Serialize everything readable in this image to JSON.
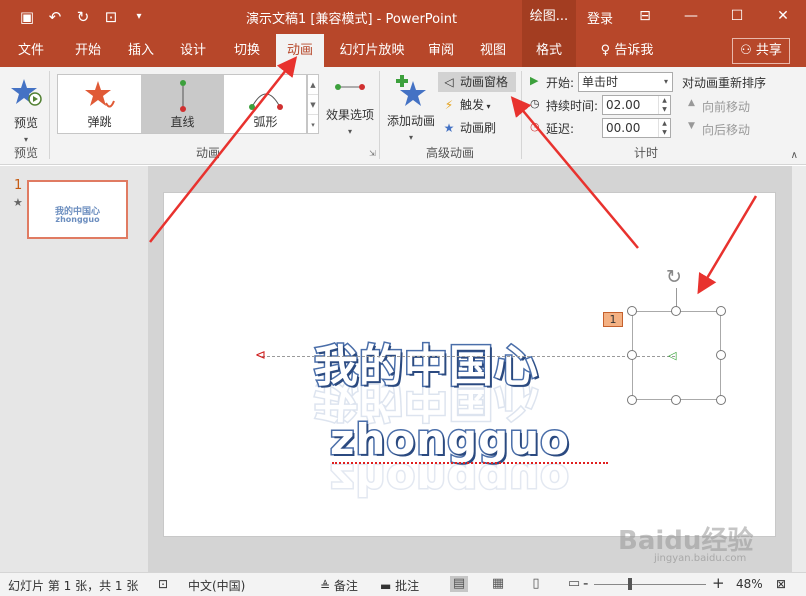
{
  "titlebar": {
    "title": "演示文稿1 [兼容模式] - PowerPoint",
    "contextual_tab_header": "绘图...",
    "login": "登录"
  },
  "tabs": {
    "file": "文件",
    "home": "开始",
    "insert": "插入",
    "design": "设计",
    "transitions": "切换",
    "animations": "动画",
    "slideshow": "幻灯片放映",
    "review": "审阅",
    "view": "视图",
    "format": "格式",
    "tell_me": "告诉我",
    "share": "共享"
  },
  "ribbon": {
    "preview": {
      "button": "预览",
      "group": "预览"
    },
    "animation": {
      "gallery": [
        "弹跳",
        "直线",
        "弧形"
      ],
      "selected": "直线",
      "effect_options": "效果选项",
      "group": "动画"
    },
    "advanced": {
      "add_animation": "添加动画",
      "animation_pane": "动画窗格",
      "trigger": "触发",
      "painter": "动画刷",
      "group": "高级动画"
    },
    "timing": {
      "start_label": "开始:",
      "start_value": "单击时",
      "duration_label": "持续时间:",
      "duration_value": "02.00",
      "delay_label": "延迟:",
      "delay_value": "00.00",
      "reorder_title": "对动画重新排序",
      "move_earlier": "向前移动",
      "move_later": "向后移动",
      "group": "计时"
    }
  },
  "thumbnails": {
    "slide_number": "1",
    "line1": "我的中国心",
    "line2": "zhongguo"
  },
  "slide": {
    "line1": "我的中国心",
    "line2": "zhongguo",
    "animation_badge": "1"
  },
  "watermark": {
    "brand": "Baidu经验",
    "url": "jingyan.baidu.com"
  },
  "statusbar": {
    "slide_info": "幻灯片 第 1 张，共 1 张",
    "language": "中文(中国)",
    "notes": "备注",
    "comments": "批注",
    "zoom_minus": "-",
    "zoom_plus": "+",
    "zoom": "48%"
  },
  "colors": {
    "accent": "#b7472a",
    "arrow": "#e8322e",
    "text_outline": "#4a6ea9"
  }
}
